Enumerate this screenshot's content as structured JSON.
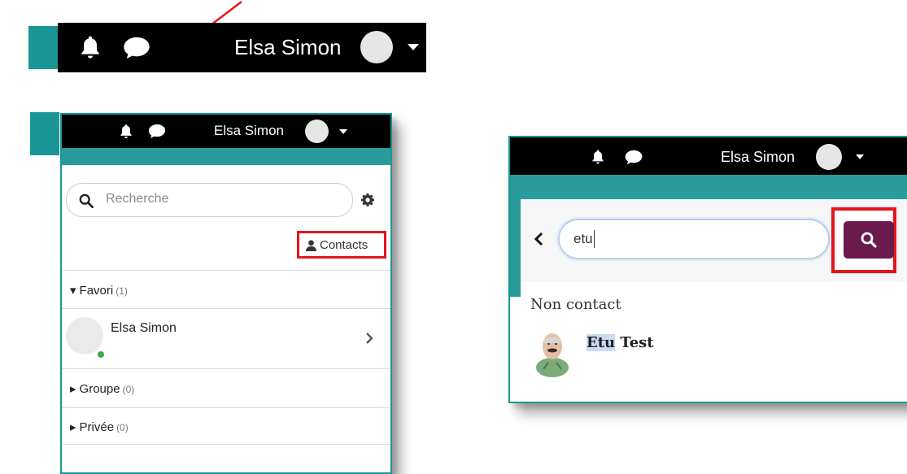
{
  "topbar": {
    "user_name": "Elsa Simon"
  },
  "left_panel": {
    "user_name": "Elsa Simon",
    "search_placeholder": "Recherche",
    "contacts_label": "Contacts",
    "sections": [
      {
        "label": "Favori",
        "count": "(1)",
        "expanded": true
      },
      {
        "label": "Groupe",
        "count": "(0)",
        "expanded": false
      },
      {
        "label": "Privée",
        "count": "(0)",
        "expanded": false
      }
    ],
    "favorite_contact": {
      "name": "Elsa Simon",
      "status": "online"
    }
  },
  "right_panel": {
    "user_name": "Elsa Simon",
    "search_value": "etu",
    "result_heading": "Non contact",
    "result": {
      "highlight": "Etu",
      "rest": " Test"
    }
  },
  "colors": {
    "teal": "#1a9696",
    "highlight_red": "#e8141c",
    "search_button": "#6b1a4e",
    "online": "#3ea84a"
  }
}
